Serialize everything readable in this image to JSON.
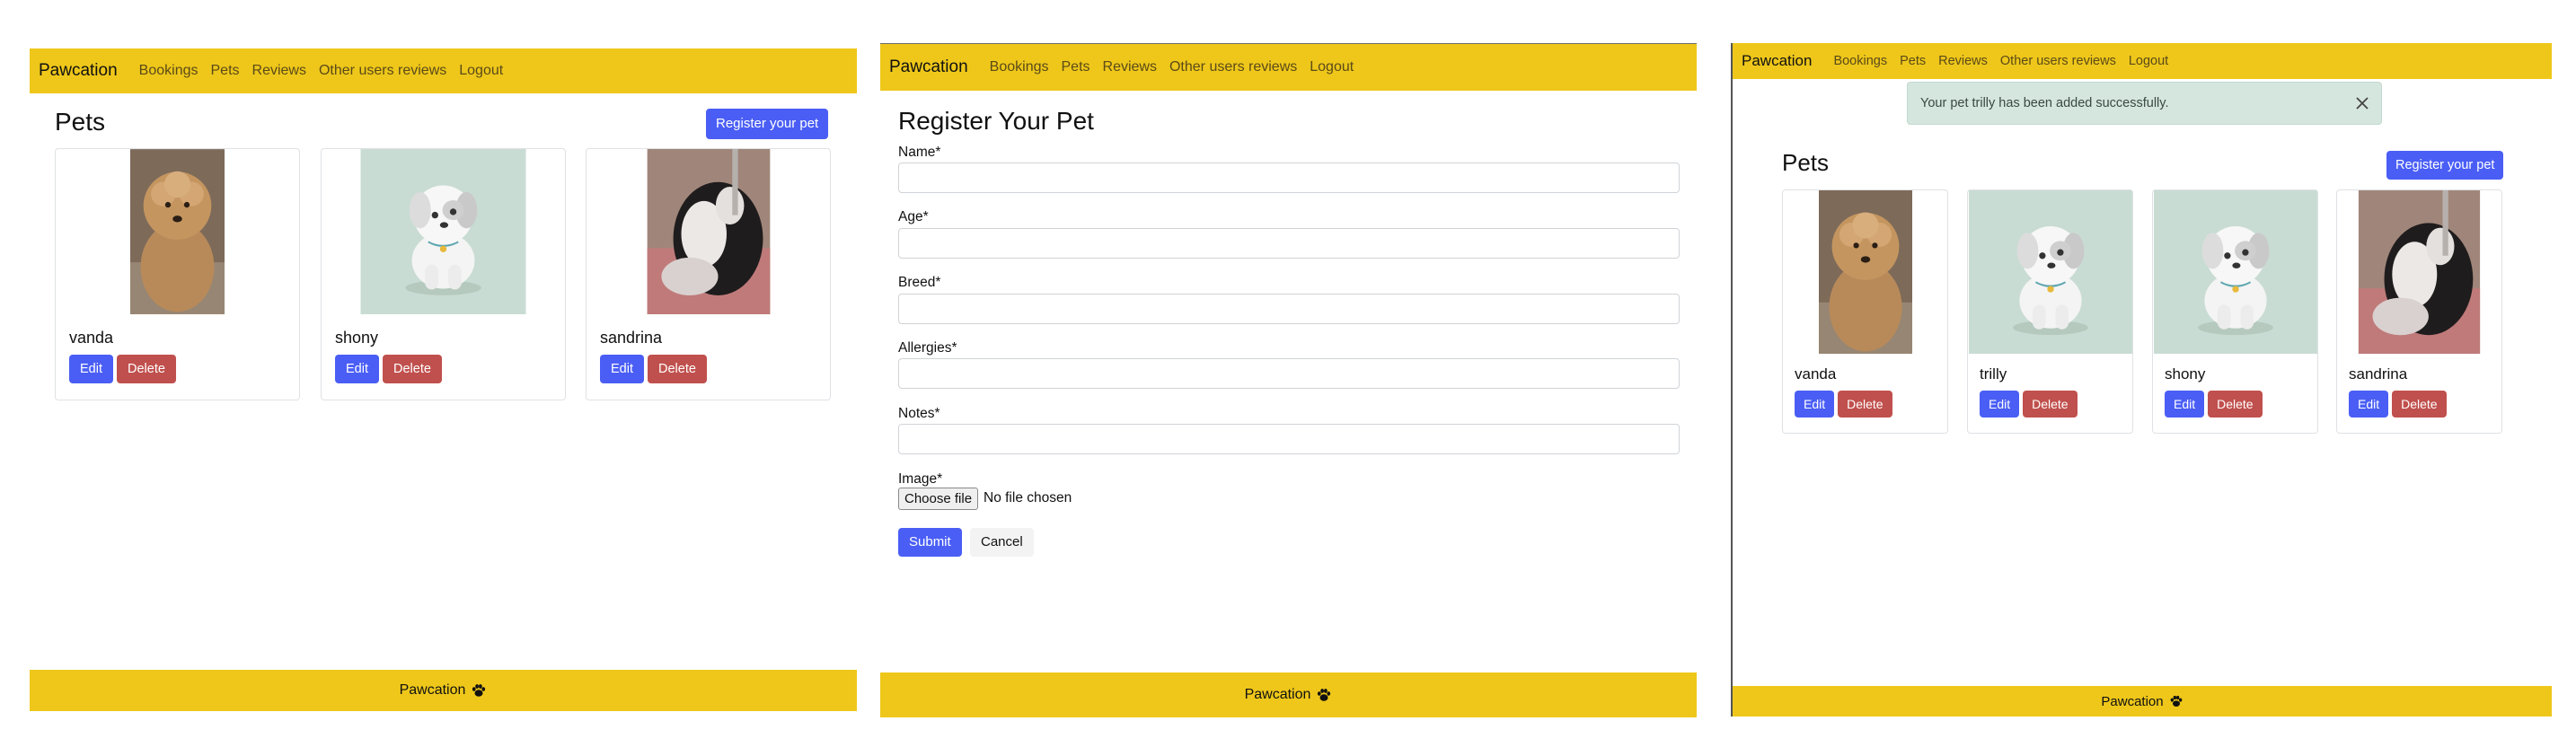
{
  "nav": {
    "brand": "Pawcation",
    "links": [
      "Bookings",
      "Pets",
      "Reviews",
      "Other users reviews",
      "Logout"
    ]
  },
  "footer": {
    "text": "Pawcation",
    "icon": "paw-icon"
  },
  "pets_page": {
    "title": "Pets",
    "register_button": "Register your pet",
    "edit_label": "Edit",
    "delete_label": "Delete"
  },
  "panel1": {
    "pets": [
      {
        "name": "vanda",
        "image": "poodle-photo"
      },
      {
        "name": "shony",
        "image": "cartoon-puppy"
      },
      {
        "name": "sandrina",
        "image": "black-white-puppy-photo"
      }
    ]
  },
  "form": {
    "title": "Register Your Pet",
    "fields": [
      {
        "label": "Name*",
        "value": ""
      },
      {
        "label": "Age*",
        "value": ""
      },
      {
        "label": "Breed*",
        "value": ""
      },
      {
        "label": "Allergies*",
        "value": ""
      },
      {
        "label": "Notes*",
        "value": ""
      }
    ],
    "image_label": "Image*",
    "file_button": "Choose file",
    "file_status": "No file chosen",
    "submit": "Submit",
    "cancel": "Cancel"
  },
  "panel3": {
    "alert": "Your pet trilly has been added successfully.",
    "pets": [
      {
        "name": "vanda",
        "image": "poodle-photo"
      },
      {
        "name": "trilly",
        "image": "cartoon-puppy"
      },
      {
        "name": "shony",
        "image": "cartoon-puppy"
      },
      {
        "name": "sandrina",
        "image": "black-white-puppy-photo"
      }
    ]
  },
  "colors": {
    "navbar": "#eec71a",
    "primary": "#4a5ef5",
    "danger": "#c0504d",
    "alert_bg": "#d5e6de",
    "puppy_bg": "#c9dcd3"
  }
}
